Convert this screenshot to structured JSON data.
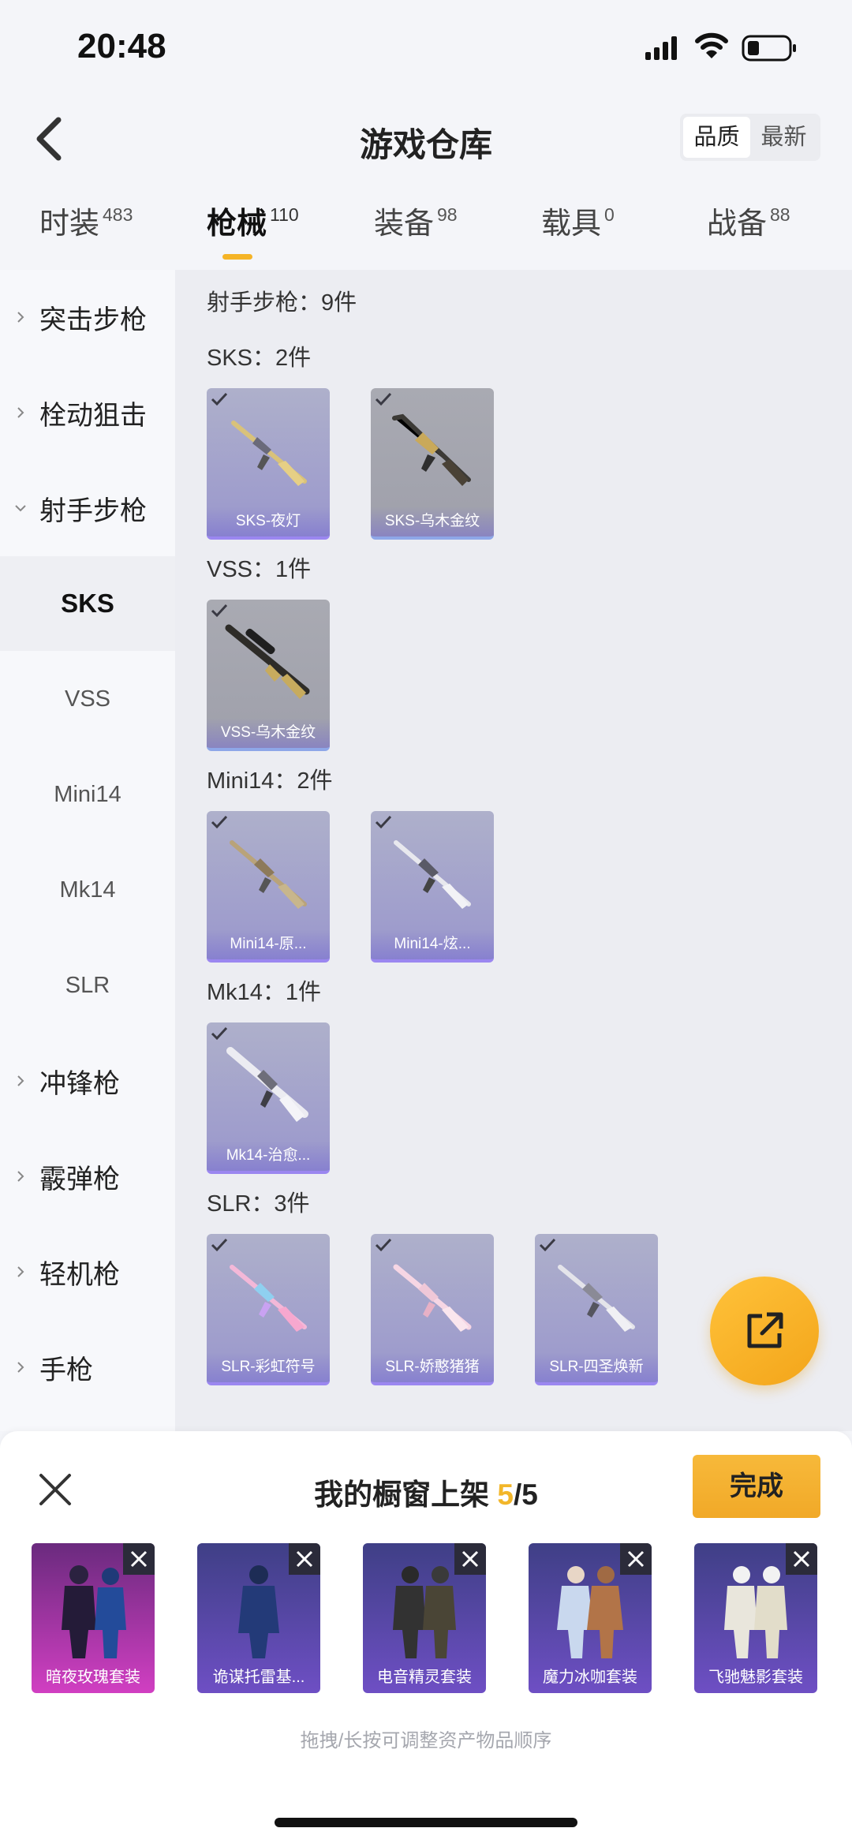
{
  "status_bar": {
    "time": "20:48"
  },
  "header": {
    "title": "游戏仓库",
    "sort_options": [
      "品质",
      "最新"
    ],
    "active_sort": 0
  },
  "tabs": [
    {
      "label": "时装",
      "count": "483"
    },
    {
      "label": "枪械",
      "count": "110",
      "active": true
    },
    {
      "label": "装备",
      "count": "98"
    },
    {
      "label": "载具",
      "count": "0"
    },
    {
      "label": "战备",
      "count": "88"
    }
  ],
  "sidebar": {
    "items": [
      {
        "label": "突击步枪",
        "type": "group",
        "expanded": false
      },
      {
        "label": "栓动狙击",
        "type": "group",
        "expanded": false
      },
      {
        "label": "射手步枪",
        "type": "group",
        "expanded": true
      },
      {
        "label": "SKS",
        "type": "sub",
        "selected": true
      },
      {
        "label": "VSS",
        "type": "sub"
      },
      {
        "label": "Mini14",
        "type": "sub"
      },
      {
        "label": "Mk14",
        "type": "sub"
      },
      {
        "label": "SLR",
        "type": "sub"
      },
      {
        "label": "冲锋枪",
        "type": "group",
        "expanded": false
      },
      {
        "label": "霰弹枪",
        "type": "group",
        "expanded": false
      },
      {
        "label": "轻机枪",
        "type": "group",
        "expanded": false
      },
      {
        "label": "手枪",
        "type": "group",
        "expanded": false
      }
    ]
  },
  "content": {
    "category_summary": "射手步枪：9件",
    "sections": [
      {
        "label": "SKS：2件",
        "items": [
          {
            "name": "SKS-夜灯",
            "style": "purple"
          },
          {
            "name": "SKS-乌木金纹",
            "style": "gray"
          }
        ]
      },
      {
        "label": "VSS：1件",
        "items": [
          {
            "name": "VSS-乌木金纹",
            "style": "gray"
          }
        ]
      },
      {
        "label": "Mini14：2件",
        "items": [
          {
            "name": "Mini14-原...",
            "style": "purple"
          },
          {
            "name": "Mini14-炫...",
            "style": "purple"
          }
        ]
      },
      {
        "label": "Mk14：1件",
        "items": [
          {
            "name": "Mk14-治愈...",
            "style": "purple"
          }
        ]
      },
      {
        "label": "SLR：3件",
        "items": [
          {
            "name": "SLR-彩虹符号",
            "style": "purple"
          },
          {
            "name": "SLR-娇憨猪猪",
            "style": "purple"
          },
          {
            "name": "SLR-四圣焕新",
            "style": "purple"
          }
        ]
      }
    ]
  },
  "bottom_panel": {
    "title_prefix": "我的橱窗上架 ",
    "current": "5",
    "total": "/5",
    "done_label": "完成",
    "outfits": [
      {
        "name": "暗夜玫瑰套装",
        "style": "pink"
      },
      {
        "name": "诡谋托雷基...",
        "style": "blue"
      },
      {
        "name": "电音精灵套装",
        "style": "blue"
      },
      {
        "name": "魔力冰咖套装",
        "style": "blue"
      },
      {
        "name": "飞驰魅影套装",
        "style": "blue"
      }
    ],
    "hint": "拖拽/长按可调整资产物品顺序"
  },
  "colors": {
    "accent": "#f5b427",
    "card_purple": "#9a97cc",
    "card_gray": "#a3a4ad",
    "outfit_pink": "#d13fc2",
    "outfit_blue": "#5c4bb6"
  }
}
